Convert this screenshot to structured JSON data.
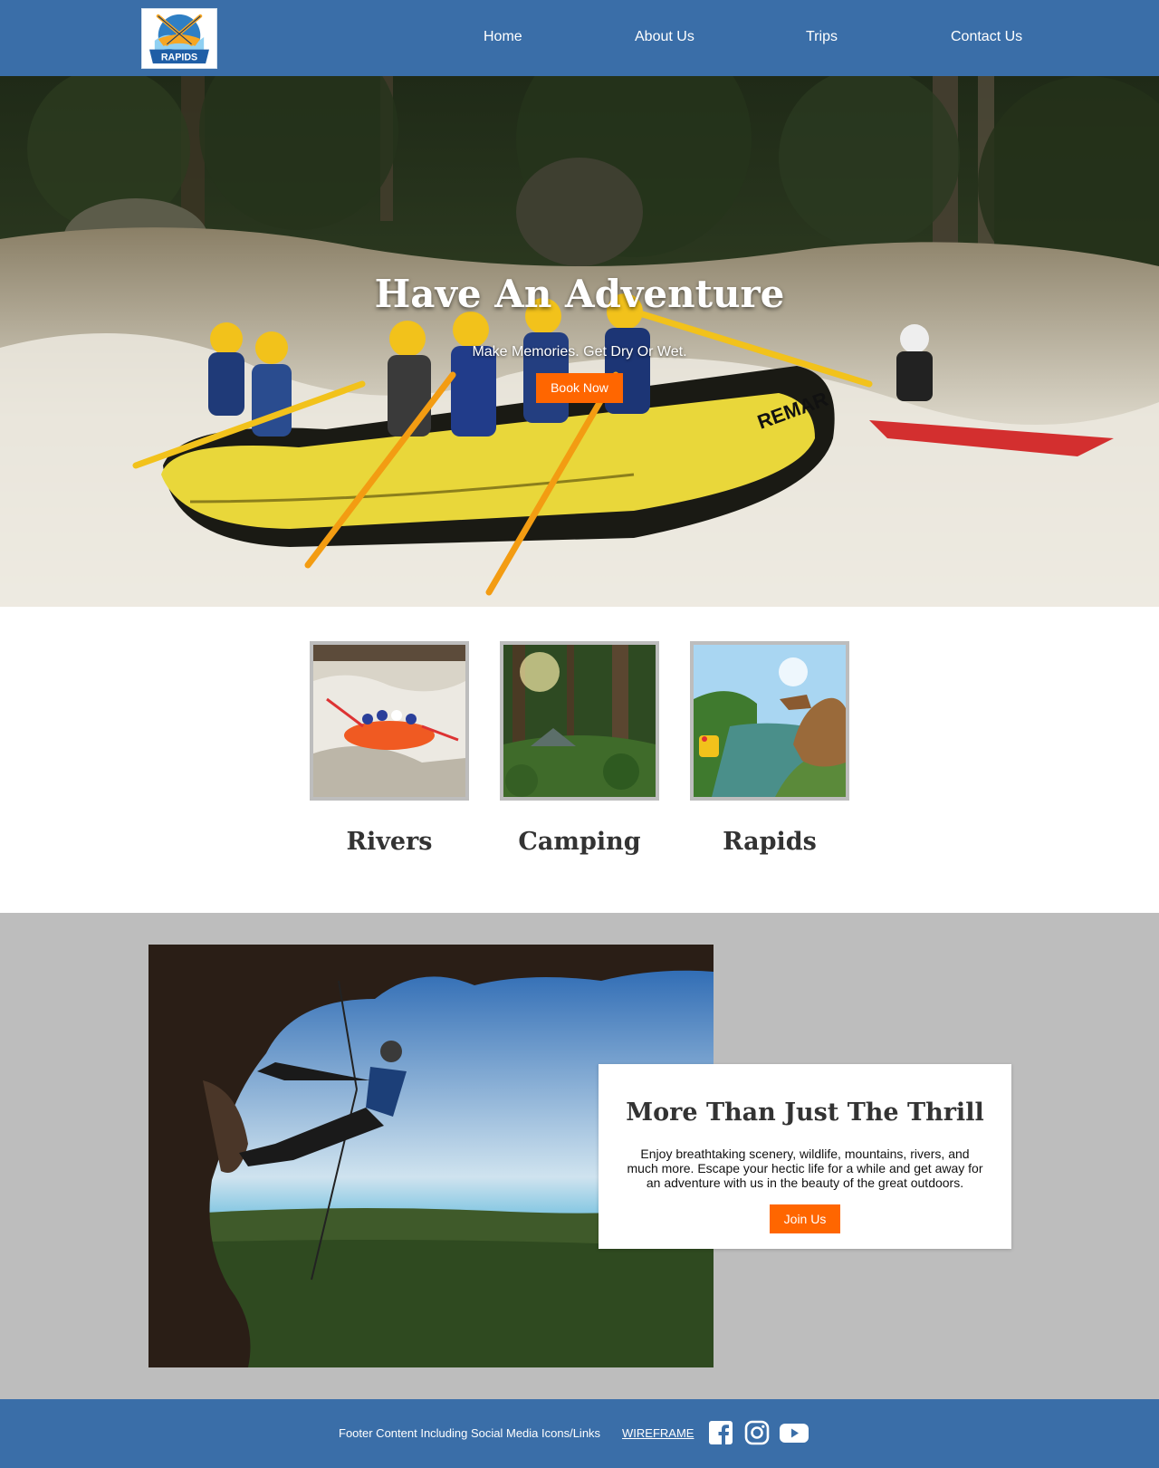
{
  "header": {
    "logo_text": "RAPIDS",
    "nav": [
      "Home",
      "About Us",
      "Trips",
      "Contact Us"
    ]
  },
  "hero": {
    "title": "Have An Adventure",
    "subtitle": "Make Memories. Get Dry Or Wet.",
    "button": "Book Now",
    "raft_text": "REMAR"
  },
  "cards": [
    {
      "label": "Rivers",
      "icon": "river-rafting-photo"
    },
    {
      "label": "Camping",
      "icon": "forest-camping-photo"
    },
    {
      "label": "Rapids",
      "icon": "dinosaur-ride-photo"
    }
  ],
  "feature": {
    "title": "More Than Just The Thrill",
    "text": "Enjoy breathtaking scenery, wildlife, mountains, rivers, and much more. Escape your hectic life for a while and get away for an adventure with us in the beauty of the great outdoors.",
    "button": "Join Us"
  },
  "footer": {
    "text": "Footer Content Including Social Media Icons/Links",
    "link": "WIREFRAME",
    "social": [
      "facebook-icon",
      "instagram-icon",
      "youtube-icon"
    ]
  },
  "colors": {
    "brand_blue": "#3a6ea8",
    "accent_orange": "#ff6600",
    "section_gray": "#bdbdbd"
  }
}
